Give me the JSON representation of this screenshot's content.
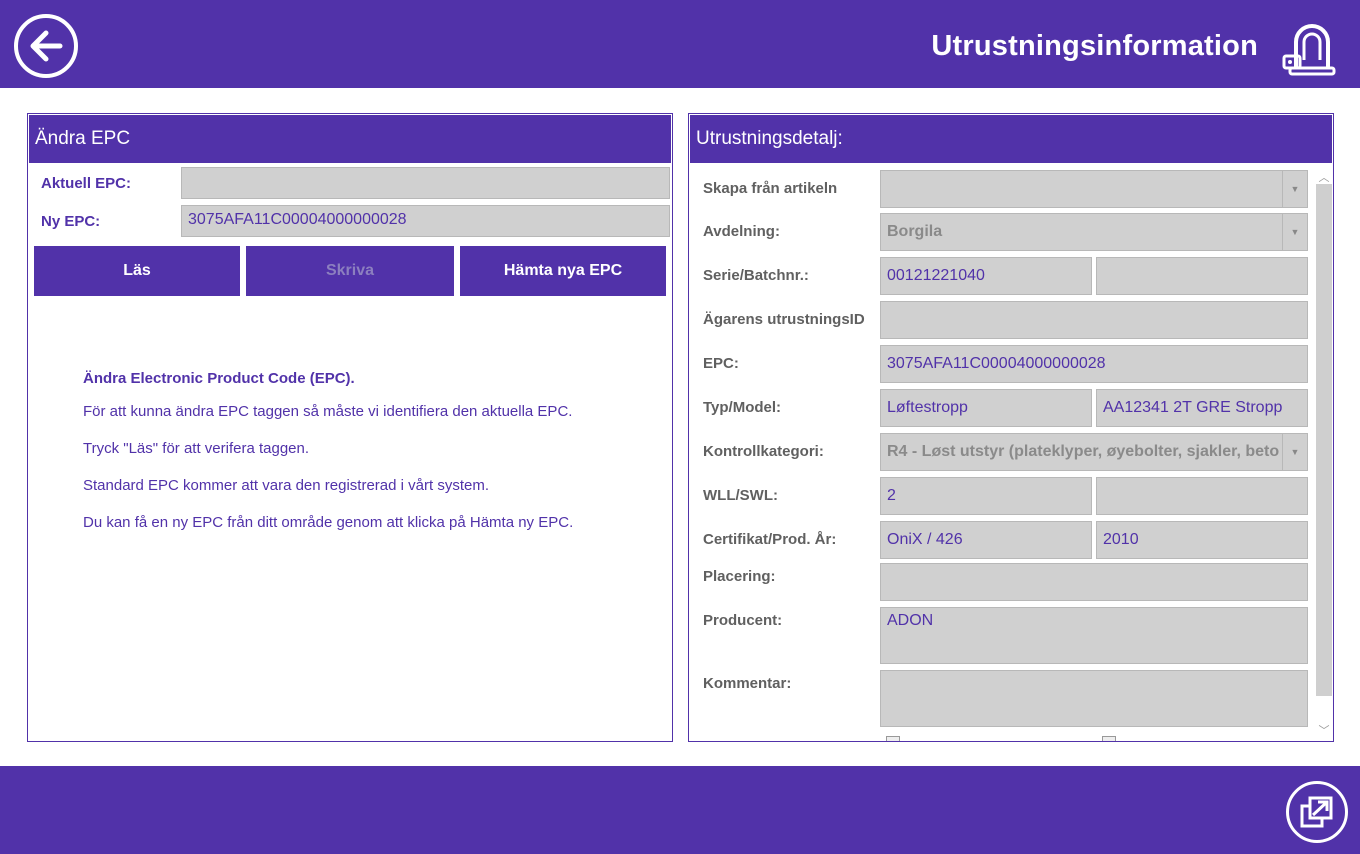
{
  "header": {
    "title": "Utrustningsinformation",
    "back_icon": "arrow-left-circle-icon",
    "logo_icon": "shackle-tag-icon"
  },
  "footer": {
    "popout_icon": "open-external-window-icon"
  },
  "colors": {
    "accent": "#5132a9",
    "field_bg": "#d0d0d0",
    "label_gray": "#606060"
  },
  "change_epc": {
    "title": "Ändra EPC",
    "current_label": "Aktuell EPC:",
    "current_value": "",
    "new_label": "Ny EPC:",
    "new_value": "3075AFA11C00004000000028",
    "buttons": {
      "read": "Läs",
      "write": "Skriva",
      "fetch": "Hämta nya EPC"
    },
    "info": {
      "heading": "Ändra Electronic Product Code (EPC).",
      "line1": "För att kunna ändra EPC taggen så måste vi identifiera den aktuella EPC.",
      "line2": "Tryck \"Läs\" för att verifera taggen.",
      "line3": "Standard EPC kommer att vara den registrerad i vårt system.",
      "line4": "Du kan få en ny EPC från ditt område genom att klicka på Hämta ny EPC."
    }
  },
  "details": {
    "title": "Utrustningsdetalj:",
    "create_from_label": "Skapa från artikeln",
    "create_from_value": "",
    "department_label": "Avdelning:",
    "department_value": "Borgila",
    "serial_label": "Serie/Batchnr.:",
    "serial_value": "00121221040",
    "serial_value2": "",
    "owner_id_label": "Ägarens utrustningsID",
    "owner_id_value": "",
    "epc_label": "EPC:",
    "epc_value": "3075AFA11C00004000000028",
    "type_label": "Typ/Model:",
    "type_value": "Løftestropp",
    "model_value": "AA12341 2T GRE Stropp",
    "category_label": "Kontrollkategori:",
    "category_value": "R4 - Løst utstyr (plateklyper, øyebolter, sjakler, beto",
    "wll_label": "WLL/SWL:",
    "wll_value": "2",
    "wll_value2": "",
    "cert_label": "Certifikat/Prod. År:",
    "cert_value": "OniX / 426",
    "year_value": "2010",
    "location_label": "Placering:",
    "location_value": "",
    "producer_label": "Producent:",
    "producer_value": "ADON",
    "comment_label": "Kommentar:",
    "comment_value": ""
  }
}
